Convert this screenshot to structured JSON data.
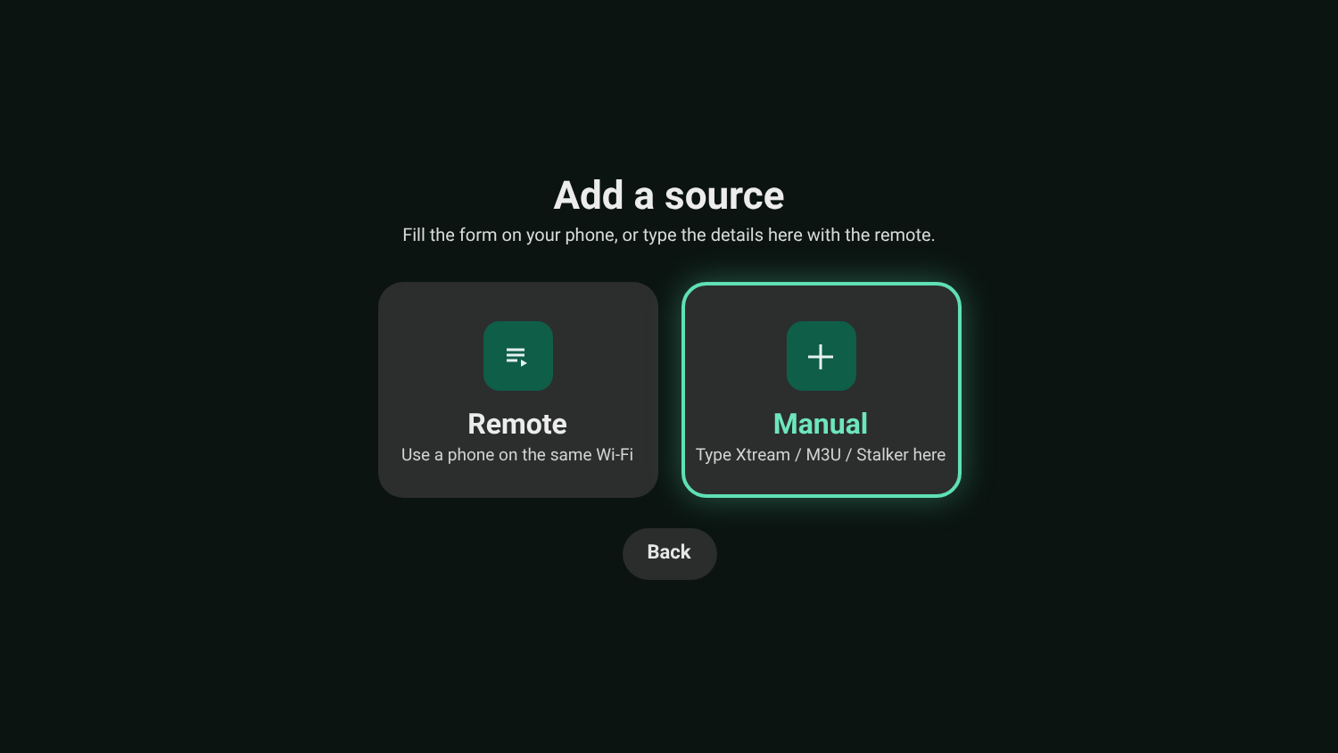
{
  "title": "Add a source",
  "subtitle": "Fill the form on your phone, or type the details here with the remote.",
  "options": [
    {
      "kind": "list",
      "label": "Remote",
      "description": "Use a phone on the same Wi-Fi",
      "selected": false
    },
    {
      "kind": "plus",
      "label": "Manual",
      "description": "Type Xtream / M3U / Stalker here",
      "selected": true
    }
  ],
  "back_button": "Back"
}
